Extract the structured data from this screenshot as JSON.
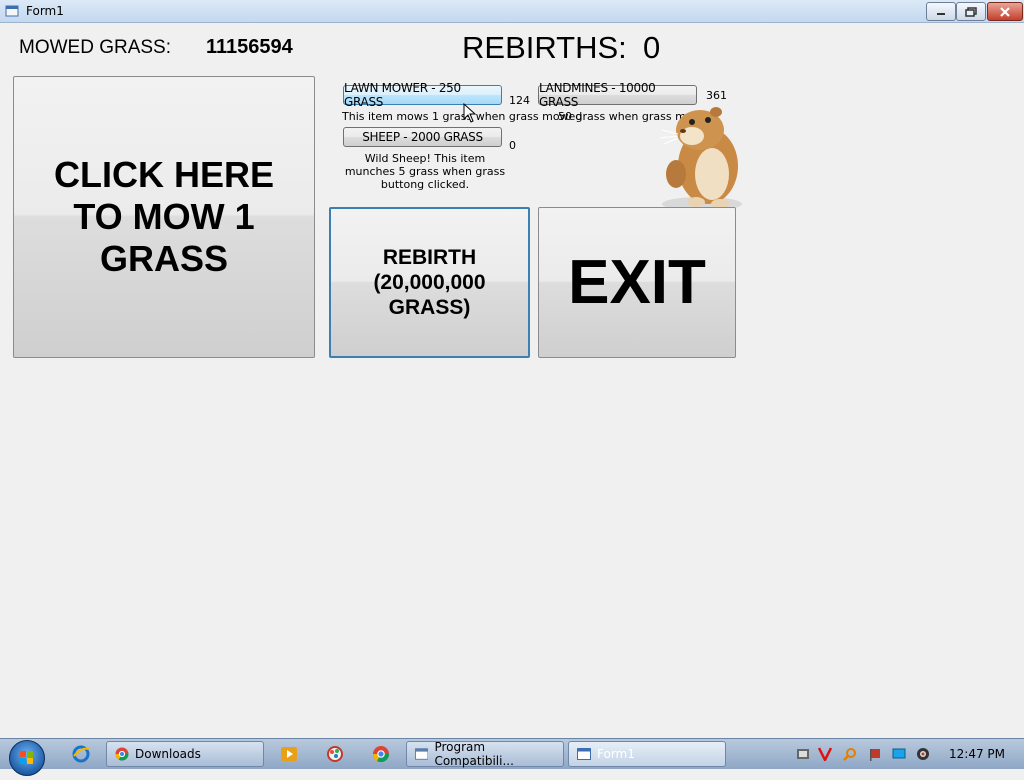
{
  "window": {
    "title": "Form1"
  },
  "stats": {
    "mowed_label": "MOWED GRASS:",
    "mowed_value": "11156594",
    "rebirths_label": "REBIRTHS:",
    "rebirths_value": "0"
  },
  "buttons": {
    "mow": "CLICK HERE TO MOW 1 GRASS",
    "rebirth": "REBIRTH (20,000,000 GRASS)",
    "exit": "EXIT"
  },
  "shop": {
    "lawn_mower": {
      "label": "LAWN MOWER - 250 GRASS",
      "count": "124",
      "description": "This item mows 1 grass when grass mowed"
    },
    "landmines": {
      "label": "LANDMINES - 10000 GRASS",
      "count": "361",
      "description": "50 grass when grass mowed"
    },
    "sheep": {
      "label": "SHEEP - 2000 GRASS",
      "count": "0",
      "description": "Wild Sheep! This item munches 5 grass when grass buttong clicked."
    }
  },
  "taskbar": {
    "items": [
      {
        "label": "Downloads",
        "icon": "chrome-icon"
      },
      {
        "label": "Program Compatibili...",
        "icon": "program-compatibility-icon"
      },
      {
        "label": "Form1",
        "icon": "form-icon"
      }
    ],
    "clock": "12:47 PM"
  },
  "colors": {
    "background": "#f0f0f0",
    "hover_button": "#bee6fd",
    "focus_border": "#3c7fb1"
  }
}
